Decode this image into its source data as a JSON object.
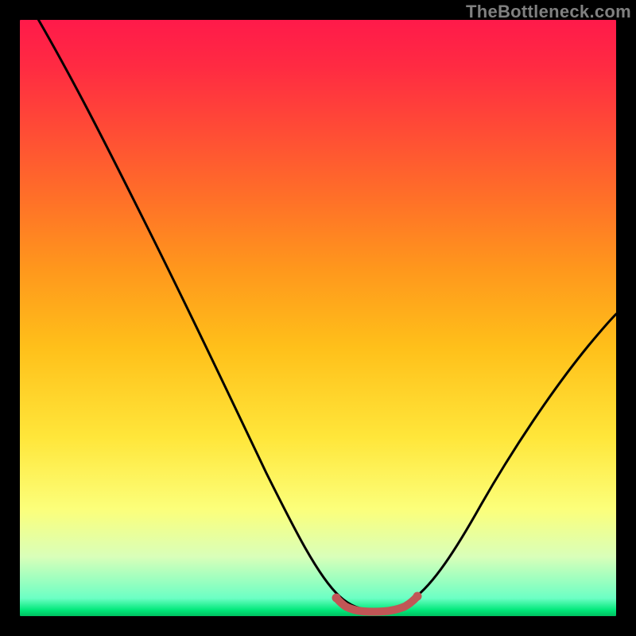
{
  "watermark": "TheBottleneck.com",
  "colors": {
    "background": "#000000",
    "gradient_top": "#ff1a4a",
    "gradient_bottom": "#00c060",
    "curve_stroke": "#000000",
    "accent_stroke": "#c15656"
  },
  "chart_data": {
    "type": "line",
    "title": "",
    "xlabel": "",
    "ylabel": "",
    "xlim": [
      0,
      1
    ],
    "ylim": [
      0,
      1
    ],
    "x": [
      0.0,
      0.05,
      0.1,
      0.15,
      0.2,
      0.25,
      0.3,
      0.35,
      0.4,
      0.45,
      0.5,
      0.53,
      0.56,
      0.6,
      0.63,
      0.67,
      0.72,
      0.78,
      0.84,
      0.9,
      0.95,
      1.0
    ],
    "values": [
      1.06,
      0.96,
      0.85,
      0.74,
      0.63,
      0.53,
      0.43,
      0.33,
      0.23,
      0.13,
      0.04,
      0.015,
      0.006,
      0.004,
      0.006,
      0.015,
      0.05,
      0.12,
      0.22,
      0.33,
      0.42,
      0.5
    ],
    "accent_segment": {
      "x": [
        0.53,
        0.56,
        0.58,
        0.6,
        0.62,
        0.64,
        0.67
      ],
      "values": [
        0.016,
        0.008,
        0.005,
        0.004,
        0.005,
        0.009,
        0.016
      ]
    },
    "annotations": [],
    "legend": []
  }
}
